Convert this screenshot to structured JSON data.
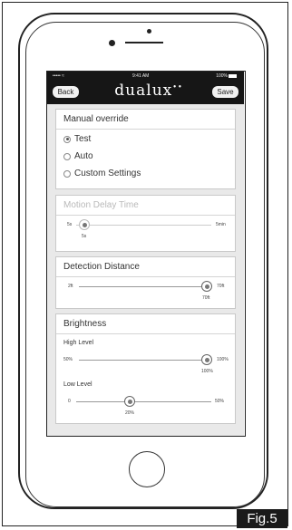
{
  "status_bar": {
    "signal": "••••• ≈",
    "time": "9:41 AM",
    "battery": "100%"
  },
  "nav": {
    "back_label": "Back",
    "brand": "dualux",
    "brand_mark": "••",
    "save_label": "Save"
  },
  "manual_override": {
    "title": "Manual override",
    "options": [
      {
        "label": "Test",
        "selected": true
      },
      {
        "label": "Auto",
        "selected": false
      },
      {
        "label": "Custom Settings",
        "selected": false
      }
    ]
  },
  "motion_delay": {
    "title": "Motion Delay Time",
    "min_label": "5s",
    "max_label": "5min",
    "value_label": "5s",
    "value_fraction": 0.0,
    "disabled": true
  },
  "detection_distance": {
    "title": "Detection Distance",
    "min_label": "2ft",
    "max_label": "70ft",
    "value_label": "70ft",
    "value_fraction": 1.0
  },
  "brightness": {
    "title": "Brightness",
    "high": {
      "label": "High Level",
      "min_label": "50%",
      "max_label": "100%",
      "value_label": "100%",
      "value_fraction": 1.0
    },
    "low": {
      "label": "Low Level",
      "min_label": "0",
      "max_label": "50%",
      "value_label": "20%",
      "value_fraction": 0.4
    }
  },
  "figure_label": "Fig.5"
}
